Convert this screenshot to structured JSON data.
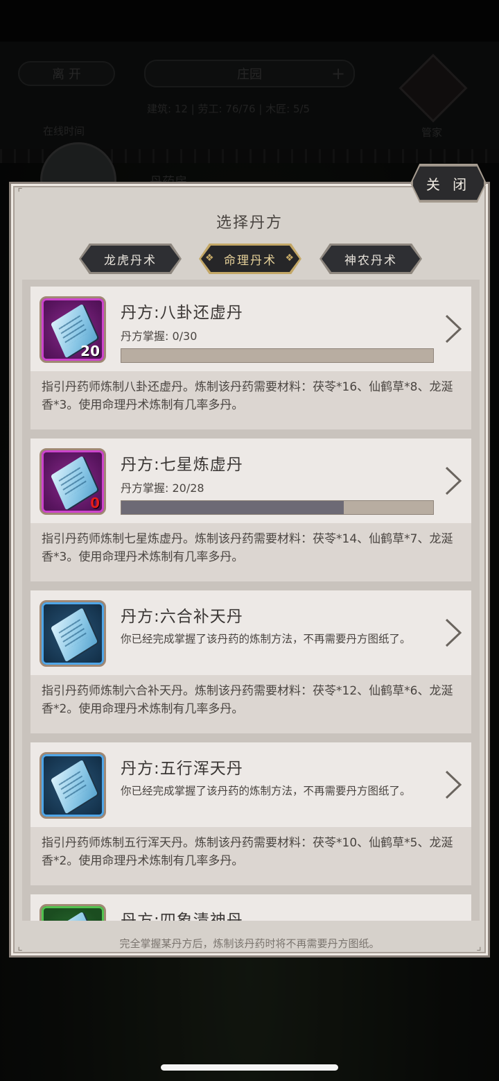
{
  "background": {
    "leave_label": "离 开",
    "estate_label": "庄园",
    "plus_label": "+",
    "stats": "建筑: 12 | 劳工: 76/76 | 木匠: 5/5",
    "housekeeper_label": "管家",
    "shop_label": "丹药房",
    "time_label": "在线时间"
  },
  "dialog": {
    "title": "选择丹方",
    "close_label": "关 闭",
    "footer_note": "完全掌握某丹方后，炼制该丹药时将不再需要丹方图纸。"
  },
  "tabs": [
    {
      "label": "龙虎丹术",
      "active": false
    },
    {
      "label": "命理丹术",
      "active": true
    },
    {
      "label": "神农丹术",
      "active": false
    }
  ],
  "recipes": [
    {
      "name": "丹方:八卦还虚丹",
      "sub": "丹方掌握: 0/30",
      "progress": 0.0,
      "count": "20",
      "icon": "scroll-icon",
      "rarity": "purple",
      "desc": "指引丹药师炼制八卦还虚丹。炼制该丹药需要材料：茯苓*16、仙鹤草*8、龙涎香*3。使用命理丹术炼制有几率多丹。"
    },
    {
      "name": "丹方:七星炼虚丹",
      "sub": "丹方掌握: 20/28",
      "progress": 0.714,
      "count": "0",
      "icon": "scroll-icon",
      "rarity": "purple",
      "desc": "指引丹药师炼制七星炼虚丹。炼制该丹药需要材料：茯苓*14、仙鹤草*7、龙涎香*3。使用命理丹术炼制有几率多丹。"
    },
    {
      "name": "丹方:六合补天丹",
      "sub": "你已经完成掌握了该丹药的炼制方法，不再需要丹方图纸了。",
      "icon": "scroll-icon",
      "rarity": "blue",
      "desc": "指引丹药师炼制六合补天丹。炼制该丹药需要材料：茯苓*12、仙鹤草*6、龙涎香*2。使用命理丹术炼制有几率多丹。"
    },
    {
      "name": "丹方:五行浑天丹",
      "sub": "你已经完成掌握了该丹药的炼制方法，不再需要丹方图纸了。",
      "icon": "scroll-icon",
      "rarity": "blue",
      "desc": "指引丹药师炼制五行浑天丹。炼制该丹药需要材料：茯苓*10、仙鹤草*5、龙涎香*2。使用命理丹术炼制有几率多丹。"
    },
    {
      "name": "丹方:四象清神丹",
      "icon": "scroll-icon",
      "rarity": "green"
    }
  ],
  "colors": {
    "dialog_bg": "#d6d1cb",
    "card_top": "#ede9e6",
    "card_bottom": "#dcd6d1",
    "progress_track": "#b8ada1",
    "progress_fill": "#6d6a75",
    "tab_active_accent": "#c3a766"
  }
}
